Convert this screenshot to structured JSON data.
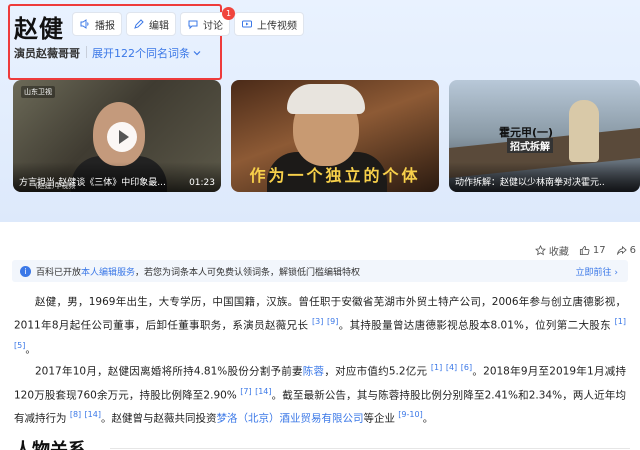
{
  "title": "赵健",
  "actions": {
    "broadcast": "播报",
    "edit": "编辑",
    "discuss": "讨论",
    "discuss_badge": "1",
    "upload_video": "上传视频"
  },
  "subtitle": "演员赵薇哥哥",
  "expand_label": "展开122个同名词条",
  "media": [
    {
      "logo": "山东卫视",
      "caption": "方言担当-赵健谈《三体》中印象最...",
      "duration": "01:23",
      "subcaption": "(赵建)中视频"
    },
    {
      "overlay": "作为一个独立的个体"
    },
    {
      "caption": "动作拆解：赵健以少林南拳对决霍元...",
      "overlay_title": "霍元甲(一)",
      "overlay_sub": "招式拆解"
    }
  ],
  "stats": {
    "collect": "收藏",
    "likes": "17",
    "shares": "6"
  },
  "notice": {
    "prefix": "百科已开放",
    "link": "本人编辑服务",
    "middle": "，若您为词条本人可免费认领词条，解锁低门槛编辑特权",
    "apply": "立即前往"
  },
  "paragraphs": {
    "p1_a": "赵健，男，1969年出生，大专学历，中国国籍，汉族。曾任职于安徽省芜湖市外贸土特产公司，2006年参与创立唐德影视，2011年8月起任公司董事，后卸任董事职务，系演员赵薇兄长",
    "p1_r1": "[3]",
    "p1_r2": "[9]",
    "p1_b": "。其持股量曾达唐德影视总股本8.01%，位列第二大股东",
    "p1_r3": "[1]",
    "p1_r4": "[5]",
    "p1_c": "。",
    "p2_a": "2017年10月，赵健因离婚将所持4.81%股份分割予前妻",
    "p2_link1": "陈蓉",
    "p2_b": "，对应市值约5.2亿元",
    "p2_r1": "[1]",
    "p2_r2": "[4]",
    "p2_r3": "[6]",
    "p2_c": "。2018年9月至2019年1月减持120万股套现760余万元，持股比例降至2.90%",
    "p2_r4": "[7]",
    "p2_r5": "[14]",
    "p2_d": "。截至最新公告，其与陈蓉持股比例分别降至2.41%和2.34%，两人近年均有减持行为",
    "p2_r6": "[8]",
    "p2_r7": "[14]",
    "p2_e": "。赵健曾与赵薇共同投资",
    "p2_link2": "梦洛（北京）酒业贸易有限公司",
    "p2_f": "等企业",
    "p2_r8": "[9-10]",
    "p2_g": "。"
  },
  "section_title": "人物关系"
}
